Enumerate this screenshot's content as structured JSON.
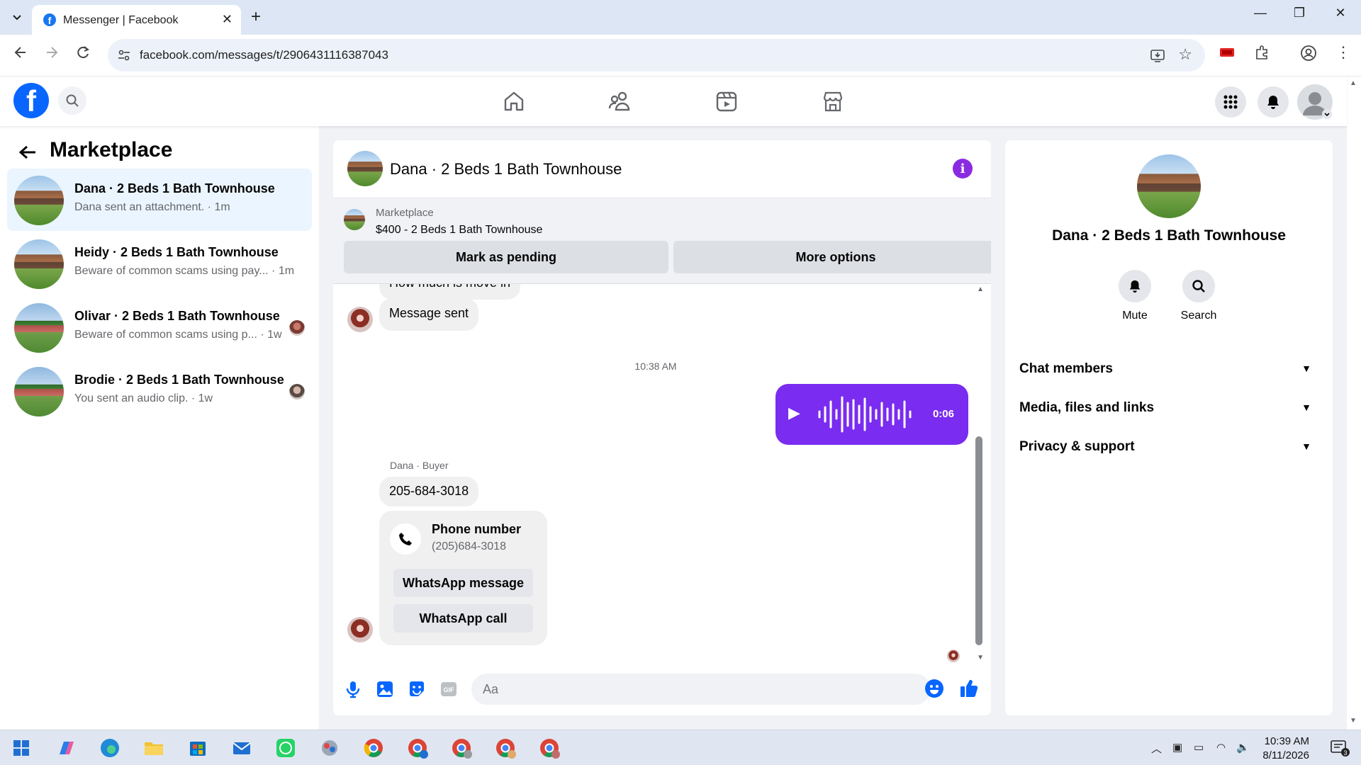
{
  "browser": {
    "tab_title": "Messenger | Facebook",
    "url": "facebook.com/messages/t/2906431116387043"
  },
  "sidebar": {
    "title": "Marketplace",
    "conversations": [
      {
        "title": "Dana · 2 Beds 1 Bath Townhouse",
        "subtitle": "Dana sent an attachment. · 1m",
        "active": true
      },
      {
        "title": "Heidy · 2 Beds 1 Bath Townhouse",
        "subtitle": "Beware of common scams using pay... · 1m",
        "active": false
      },
      {
        "title": "Olivar · 2 Beds 1 Bath Townhouse",
        "subtitle": "Beware of common scams using p... · 1w",
        "active": false
      },
      {
        "title": "Brodie · 2 Beds 1 Bath Townhouse",
        "subtitle": "You sent an audio clip. · 1w",
        "active": false
      }
    ]
  },
  "chat": {
    "title": "Dana · 2 Beds 1 Bath Townhouse",
    "listing": {
      "category": "Marketplace",
      "price_title": "$400 - 2 Beds 1 Bath Townhouse",
      "mark_pending": "Mark as pending",
      "more_options": "More options"
    },
    "messages": {
      "partial_text": "How much is move in",
      "message_sent": "Message sent",
      "timestamp": "10:38 AM",
      "audio_duration": "0:06",
      "sender_label": "Dana · Buyer",
      "phone_text": "205-684-3018",
      "phone_card_title": "Phone number",
      "phone_card_number": "(205)684-3018",
      "whatsapp_message": "WhatsApp message",
      "whatsapp_call": "WhatsApp call"
    },
    "composer_placeholder": "Aa"
  },
  "info_panel": {
    "name": "Dana · 2 Beds 1 Bath Townhouse",
    "actions": [
      "Mute",
      "Search"
    ],
    "sections": [
      "Chat members",
      "Media, files and links",
      "Privacy & support"
    ]
  },
  "taskbar": {
    "time": "10:39 AM",
    "date": "8/11/2026",
    "notification_count": "3"
  },
  "colors": {
    "fb_blue": "#0866ff",
    "audio_purple": "#7a2cf0",
    "info_purple": "#8a2be2",
    "active_conv_bg": "#ebf5ff"
  }
}
